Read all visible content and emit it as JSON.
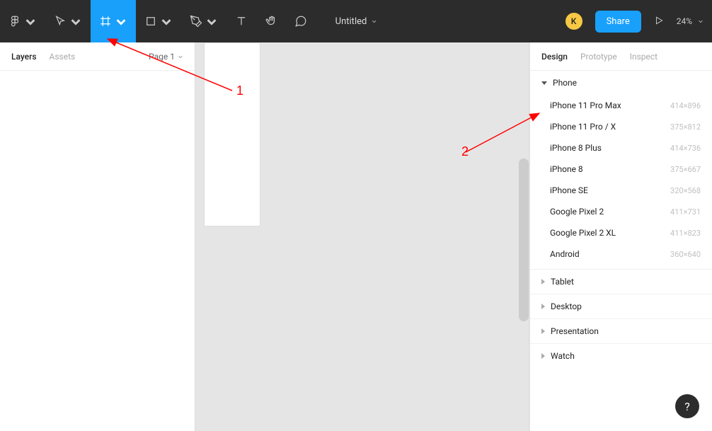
{
  "toolbar": {
    "title": "Untitled",
    "avatar_letter": "K",
    "share_label": "Share",
    "zoom_label": "24%"
  },
  "left_panel": {
    "tabs": {
      "layers": "Layers",
      "assets": "Assets"
    },
    "page_selector": "Page 1"
  },
  "right_panel": {
    "tabs": {
      "design": "Design",
      "prototype": "Prototype",
      "inspect": "Inspect"
    },
    "phone_section": "Phone",
    "devices": [
      {
        "name": "iPhone 11 Pro Max",
        "dims": "414×896"
      },
      {
        "name": "iPhone 11 Pro / X",
        "dims": "375×812"
      },
      {
        "name": "iPhone 8 Plus",
        "dims": "414×736"
      },
      {
        "name": "iPhone 8",
        "dims": "375×667"
      },
      {
        "name": "iPhone SE",
        "dims": "320×568"
      },
      {
        "name": "Google Pixel 2",
        "dims": "411×731"
      },
      {
        "name": "Google Pixel 2 XL",
        "dims": "411×823"
      },
      {
        "name": "Android",
        "dims": "360×640"
      }
    ],
    "collapsed_sections": [
      "Tablet",
      "Desktop",
      "Presentation",
      "Watch"
    ]
  },
  "annotations": {
    "first": "1",
    "second": "2"
  },
  "help": "?"
}
